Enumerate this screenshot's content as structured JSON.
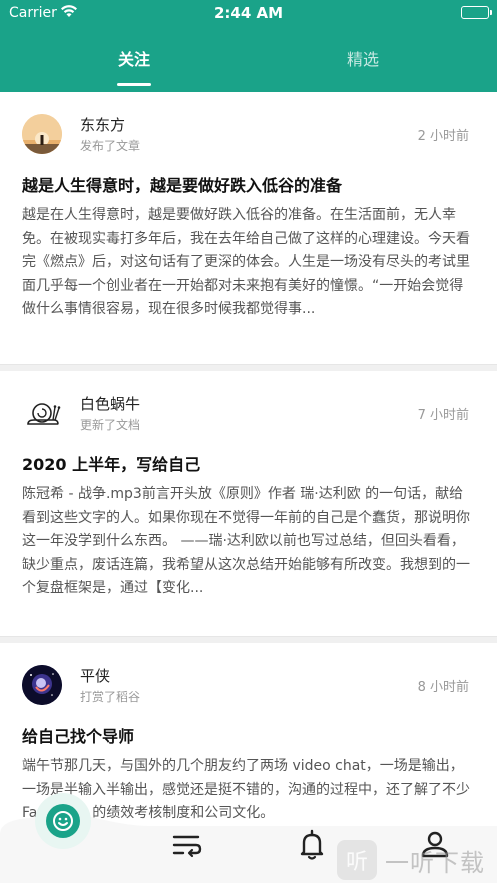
{
  "status_bar": {
    "carrier": "Carrier",
    "time": "2:44 AM"
  },
  "tabs": [
    {
      "label": "关注",
      "active": true
    },
    {
      "label": "精选",
      "active": false
    }
  ],
  "posts": [
    {
      "author": "东东方",
      "action": "发布了文章",
      "time": "2 小时前",
      "title": "越是人生得意时，越是要做好跌入低谷的准备",
      "excerpt": "越是在人生得意时，越是要做好跌入低谷的准备。在生活面前，无人幸免。在被现实毒打多年后，我在去年给自己做了这样的心理建设。今天看完《燃点》后，对这句话有了更深的体会。人生是一场没有尽头的考试里面几乎每一个创业者在一开始都对未来抱有美好的憧憬。“一开始会觉得做什么事情很容易，现在很多时候我都觉得事..."
    },
    {
      "author": "白色蜗牛",
      "action": "更新了文档",
      "time": "7 小时前",
      "title": "2020 上半年，写给自己",
      "excerpt": "陈冠希 - 战争.mp3前言开头放《原则》作者 瑞·达利欧 的一句话，献给看到这些文字的人。如果你现在不觉得一年前的自己是个蠢货，那说明你这一年没学到什么东西。 ——瑞·达利欧以前也写过总结，但回头看看，缺少重点，废话连篇，我希望从这次总结开始能够有所改变。我想到的一个复盘框架是，通过【变化..."
    },
    {
      "author": "平侠",
      "action": "打赏了稻谷",
      "time": "8 小时前",
      "title": "给自己找个导师",
      "excerpt": "端午节那几天，与国外的几个朋友约了两场 video chat，一场是输出，一场是半输入半输出，感觉还是挺不错的，沟通的过程中，还了解了不少 Facebook 的绩效考核制度和公司文化。"
    }
  ],
  "tab_bar": {
    "items": [
      "smiley-icon",
      "list-icon",
      "bell-icon",
      "user-icon"
    ]
  },
  "watermark": {
    "badge": "听",
    "text": "一听下载"
  },
  "colors": {
    "brand": "#1aa389",
    "text_primary": "#111111",
    "text_secondary": "#555555",
    "meta": "#999999"
  }
}
